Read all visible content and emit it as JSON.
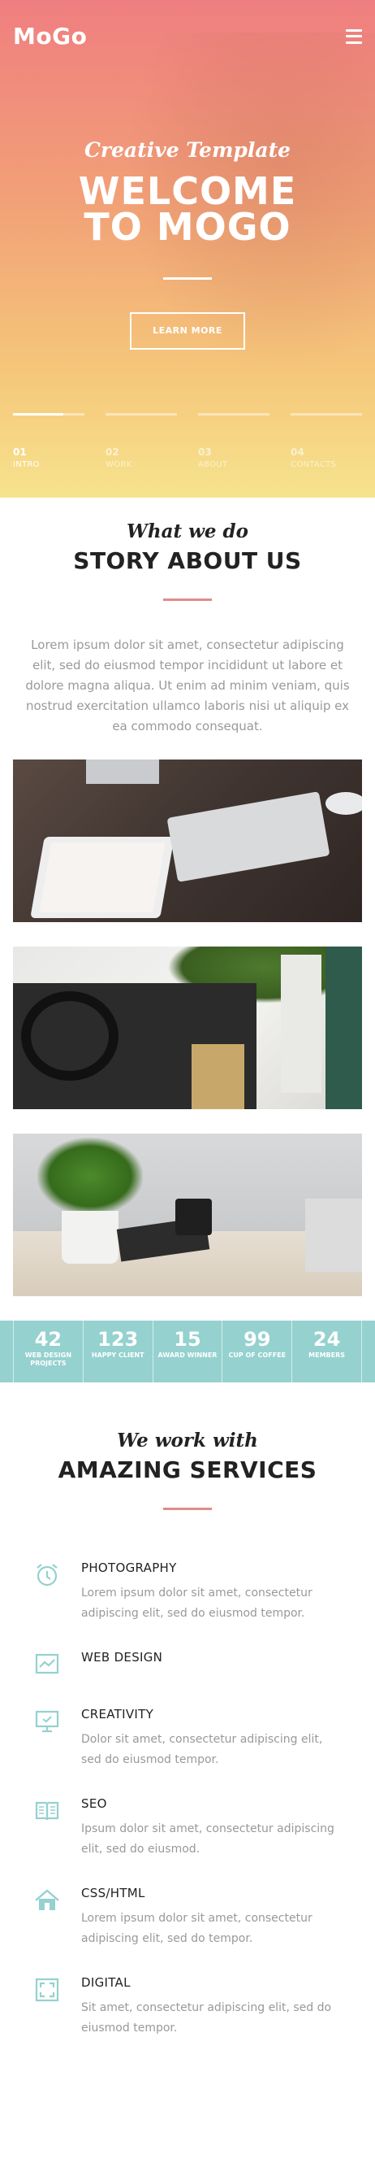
{
  "header": {
    "logo": "MoGo",
    "menu_icon": "hamburger-icon"
  },
  "hero": {
    "subtitle": "Creative Template",
    "title_line1": "WELCOME",
    "title_line2": "TO MOGO",
    "button_label": "LEARN MORE",
    "slides": [
      {
        "num": "01",
        "label": "INTRO",
        "progress": 0.7,
        "active": true
      },
      {
        "num": "02",
        "label": "WORK",
        "progress": 0,
        "active": false
      },
      {
        "num": "03",
        "label": "ABOUT",
        "progress": 0,
        "active": false
      },
      {
        "num": "04",
        "label": "CONTACTS",
        "progress": 0,
        "active": false
      }
    ]
  },
  "about": {
    "script": "What we do",
    "title": "STORY ABOUT US",
    "text": "Lorem ipsum dolor sit amet, consectetur adipiscing elit, sed do eiusmod tempor incididunt ut labore et dolore magna aliqua. Ut enim ad minim veniam, quis nostrud exercitation ullamco laboris nisi ut aliquip ex ea commodo consequat."
  },
  "stats": [
    {
      "number": "42",
      "label": "WEB DESIGN PROJECTS"
    },
    {
      "number": "123",
      "label": "HAPPY CLIENT"
    },
    {
      "number": "15",
      "label": "AWARD WINNER"
    },
    {
      "number": "99",
      "label": "CUP OF COFFEE"
    },
    {
      "number": "24",
      "label": "MEMBERS"
    }
  ],
  "services": {
    "script": "We work with",
    "title": "AMAZING SERVICES",
    "items": [
      {
        "title": "PHOTOGRAPHY",
        "desc": "Lorem ipsum dolor sit amet, consectetur adipiscing elit, sed do eiusmod tempor.",
        "icon": "alarm-clock-icon"
      },
      {
        "title": "WEB DESIGN",
        "desc": "",
        "icon": "chart-monitor-icon"
      },
      {
        "title": "CREATIVITY",
        "desc": "Dolor sit amet, consectetur adipiscing elit, sed do eiusmod tempor.",
        "icon": "monitor-icon"
      },
      {
        "title": "SEO",
        "desc": "Ipsum dolor sit amet, consectetur adipiscing elit, sed do eiusmod.",
        "icon": "book-icon"
      },
      {
        "title": "CSS/HTML",
        "desc": "Lorem ipsum dolor sit amet, consectetur adipiscing elit, sed do tempor.",
        "icon": "house-icon"
      },
      {
        "title": "DIGITAL",
        "desc": "Sit amet, consectetur adipiscing elit, sed do eiusmod tempor.",
        "icon": "expand-icon"
      }
    ]
  },
  "colors": {
    "accent": "#95d1cf",
    "hero_top": "#ef7e80",
    "hero_bottom": "#f7e38e",
    "divider": "#e28a8a"
  }
}
